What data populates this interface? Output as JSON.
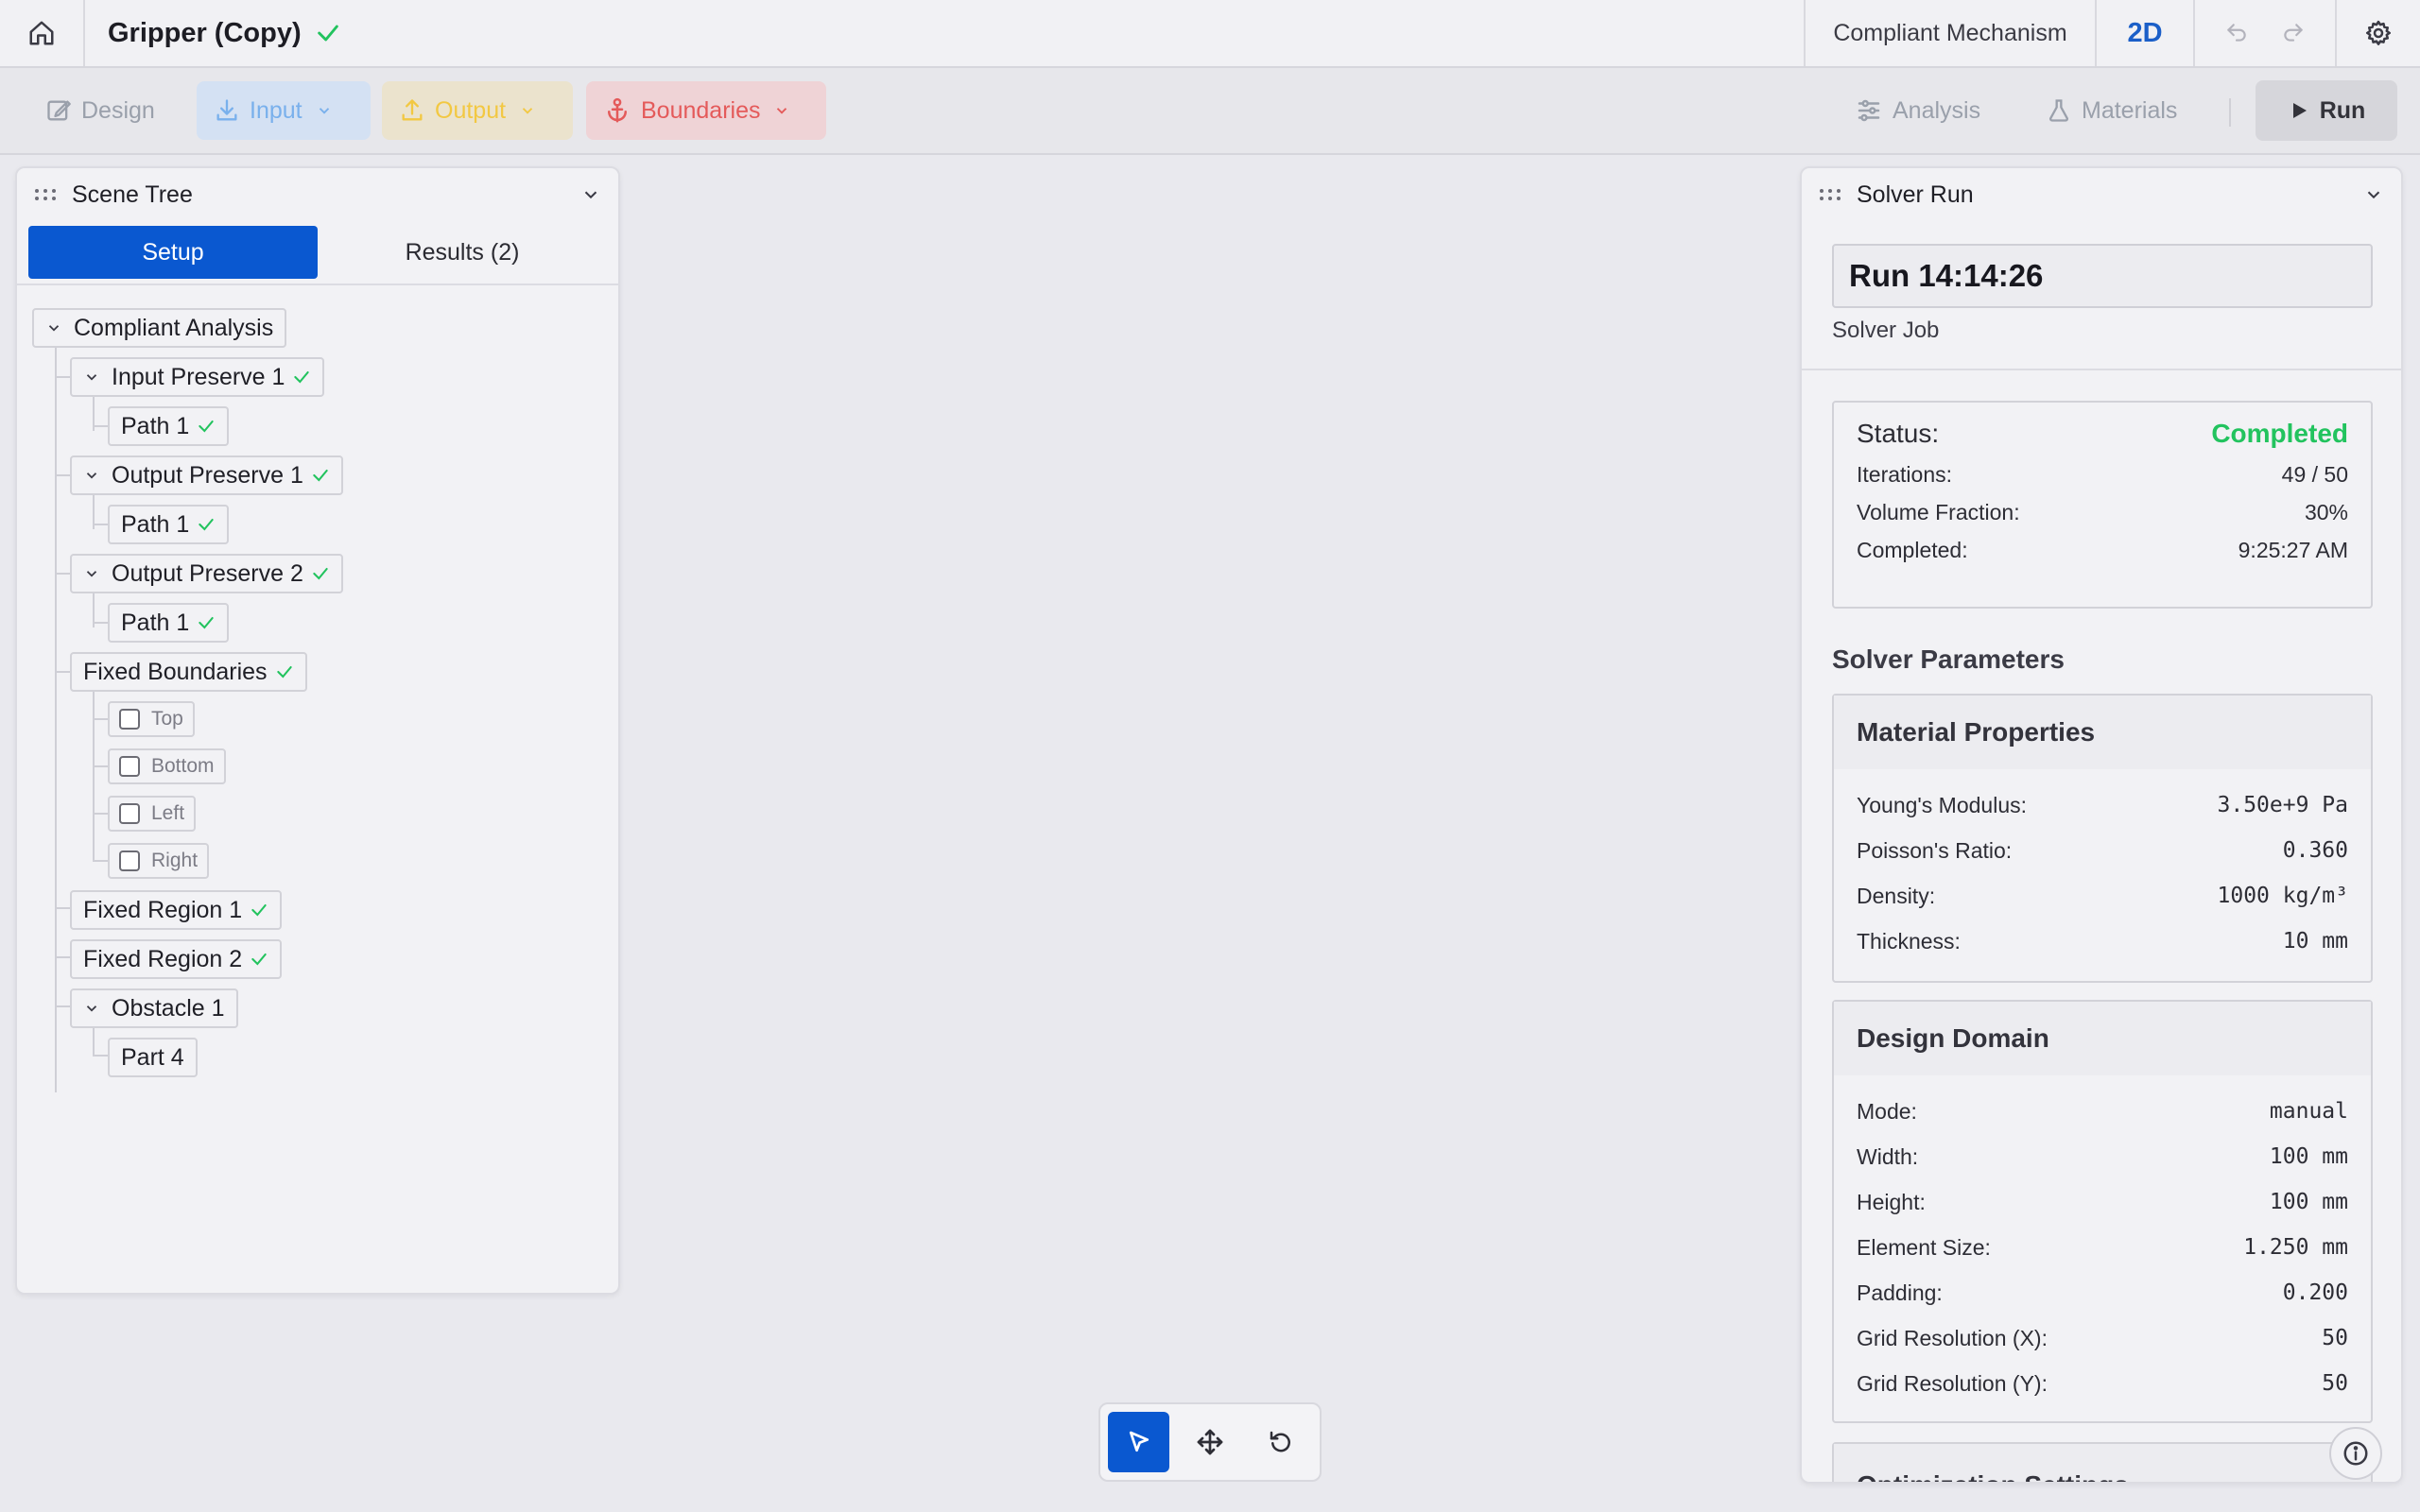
{
  "topbar": {
    "title": "Gripper (Copy)",
    "mode": "Compliant Mechanism",
    "view": "2D"
  },
  "toolbar": {
    "design": "Design",
    "input": "Input",
    "output": "Output",
    "boundaries": "Boundaries",
    "analysis": "Analysis",
    "materials": "Materials",
    "run": "Run"
  },
  "scene_tree": {
    "title": "Scene Tree",
    "tab_setup": "Setup",
    "tab_results": "Results (2)",
    "nodes": {
      "root": "Compliant Analysis",
      "input_preserve": "Input Preserve 1",
      "input_path": "Path 1",
      "output_preserve_1": "Output Preserve 1",
      "output_path_1": "Path 1",
      "output_preserve_2": "Output Preserve 2",
      "output_path_2": "Path 1",
      "fixed_boundaries": "Fixed Boundaries",
      "top": "Top",
      "bottom": "Bottom",
      "left": "Left",
      "right": "Right",
      "fixed_region_1": "Fixed Region 1",
      "fixed_region_2": "Fixed Region 2",
      "obstacle": "Obstacle 1",
      "part": "Part 4"
    }
  },
  "solver": {
    "title": "Solver Run",
    "run_name": "Run 14:14:26",
    "run_sub": "Solver Job",
    "status_label": "Status:",
    "status_value": "Completed",
    "iterations_label": "Iterations:",
    "iterations_value": "49 / 50",
    "volume_label": "Volume Fraction:",
    "volume_value": "30%",
    "completed_label": "Completed:",
    "completed_value": "9:25:27 AM",
    "params_title": "Solver Parameters",
    "material": {
      "title": "Material Properties",
      "youngs_label": "Young's Modulus:",
      "youngs_value": "3.50e+9 Pa",
      "poisson_label": "Poisson's Ratio:",
      "poisson_value": "0.360",
      "density_label": "Density:",
      "density_value": "1000 kg/m³",
      "thickness_label": "Thickness:",
      "thickness_value": "10 mm"
    },
    "domain": {
      "title": "Design Domain",
      "mode_label": "Mode:",
      "mode_value": "manual",
      "width_label": "Width:",
      "width_value": "100 mm",
      "height_label": "Height:",
      "height_value": "100 mm",
      "element_label": "Element Size:",
      "element_value": "1.250 mm",
      "padding_label": "Padding:",
      "padding_value": "0.200",
      "gridx_label": "Grid Resolution (X):",
      "gridx_value": "50",
      "gridy_label": "Grid Resolution (Y):",
      "gridy_value": "50"
    },
    "opt_title": "Optimization Settings"
  },
  "colors": {
    "accent": "#0a58d0",
    "success": "#22c35e",
    "input": "#79b0ec",
    "output": "#f2c842",
    "boundaries": "#e45a5a"
  }
}
